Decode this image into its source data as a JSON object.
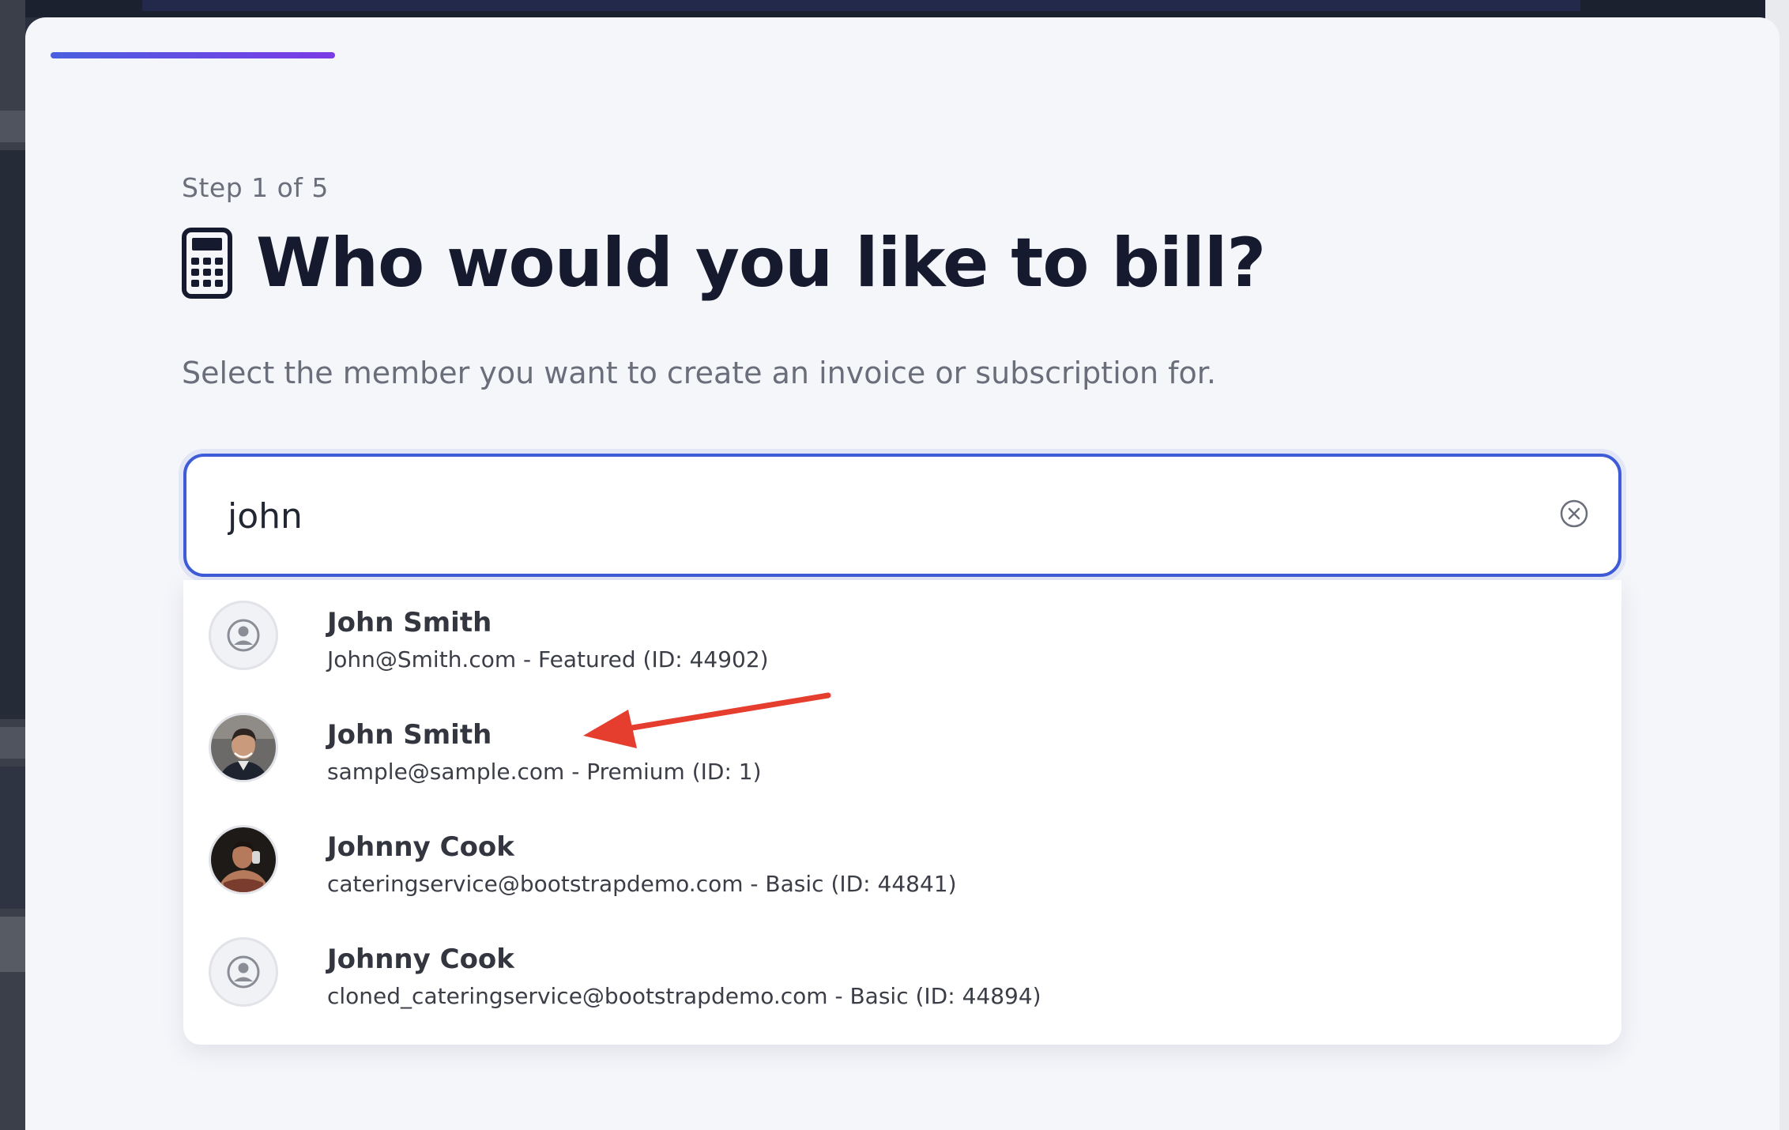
{
  "wizard": {
    "step_label": "Step 1 of 5",
    "progress_fraction": 0.2,
    "title": "Who would you like to bill?",
    "title_icon": "calculator-icon",
    "subtitle": "Select the member you want to create an invoice or subscription for."
  },
  "search": {
    "value": "john",
    "clear_icon": "clear-circle-icon"
  },
  "results": [
    {
      "name": "John Smith",
      "detail": "John@Smith.com - Featured (ID: 44902)",
      "avatar": "user-placeholder-icon"
    },
    {
      "name": "John Smith",
      "detail": "sample@sample.com - Premium (ID: 1)",
      "avatar": "profile-photo"
    },
    {
      "name": "Johnny Cook",
      "detail": "cateringservice@bootstrapdemo.com - Basic (ID: 44841)",
      "avatar": "profile-photo"
    },
    {
      "name": "Johnny Cook",
      "detail": "cloned_cateringservice@bootstrapdemo.com - Basic (ID: 44894)",
      "avatar": "user-placeholder-icon"
    }
  ],
  "colors": {
    "accent": "#3e5bd8",
    "annotation_arrow": "#e53d2e",
    "background": "#f5f6fa"
  }
}
